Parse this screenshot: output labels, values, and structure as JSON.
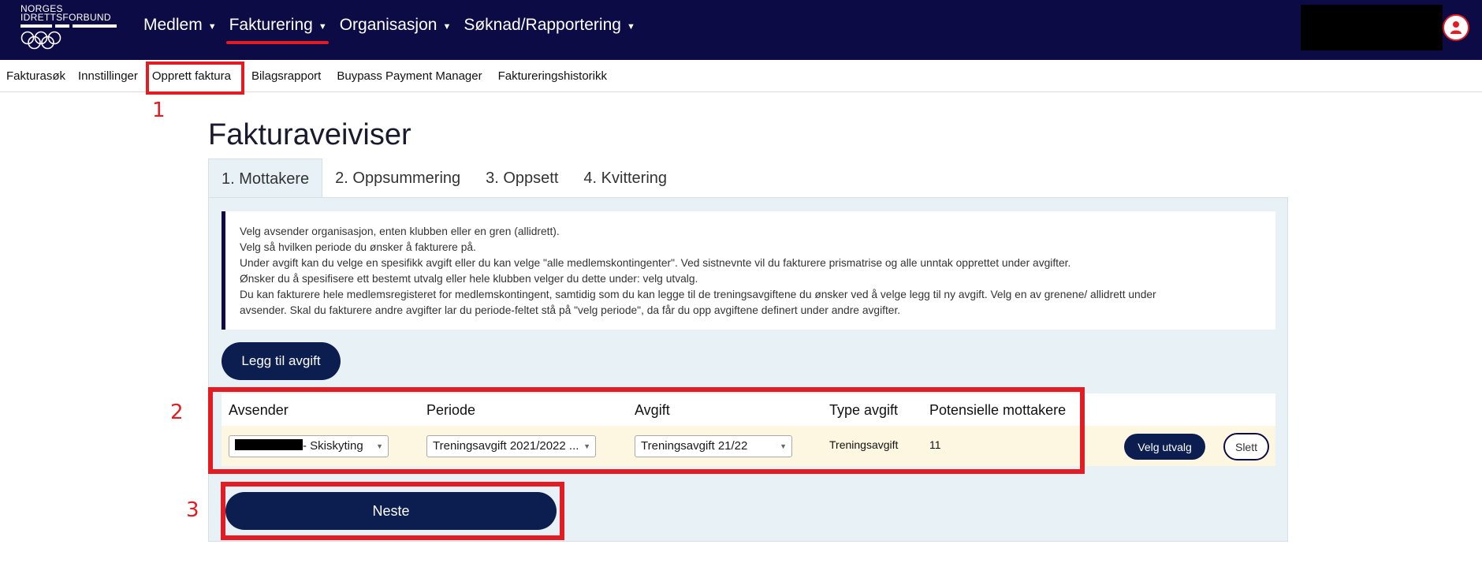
{
  "logo": {
    "line1": "NORGES",
    "line2": "IDRETTSFORBUND"
  },
  "nav": {
    "items": [
      {
        "label": "Medlem"
      },
      {
        "label": "Fakturering"
      },
      {
        "label": "Organisasjon"
      },
      {
        "label": "Søknad/Rapportering"
      }
    ]
  },
  "subnav": {
    "items": [
      {
        "label": "Fakturasøk"
      },
      {
        "label": "Innstillinger"
      },
      {
        "label": "Opprett faktura"
      },
      {
        "label": "Bilagsrapport"
      },
      {
        "label": "Buypass Payment Manager"
      },
      {
        "label": "Faktureringshistorikk"
      }
    ]
  },
  "annotations": {
    "step1": "1",
    "step2": "2",
    "step3": "3"
  },
  "page": {
    "title": "Fakturaveiviser"
  },
  "tabs": [
    {
      "label": "1. Mottakere"
    },
    {
      "label": "2. Oppsummering"
    },
    {
      "label": "3. Oppsett"
    },
    {
      "label": "4. Kvittering"
    }
  ],
  "info": {
    "lines": [
      "Velg avsender organisasjon, enten klubben eller en gren (allidrett).",
      "Velg så hvilken periode du ønsker å fakturere på.",
      "Under avgift kan du velge en spesifikk avgift eller du kan velge \"alle medlemskontingenter\". Ved sistnevnte vil du fakturere prismatrise og alle unntak opprettet under avgifter.",
      "Ønsker du å spesifisere ett bestemt utvalg eller hele klubben velger du dette under: velg utvalg.",
      "Du kan fakturere hele medlemsregisteret for medlemskontingent, samtidig som du kan legge til de treningsavgiftene du ønsker ved å velge legg til ny avgift. Velg en av grenene/ allidrett under",
      "avsender. Skal du fakturere andre avgifter lar du periode-feltet stå på \"velg periode\", da får du opp avgiftene definert under andre avgifter."
    ]
  },
  "buttons": {
    "add_fee": "Legg til avgift",
    "next": "Neste",
    "select_group": "Velg utvalg",
    "delete": "Slett"
  },
  "table": {
    "headers": {
      "sender": "Avsender",
      "period": "Periode",
      "fee": "Avgift",
      "fee_type": "Type avgift",
      "recipients": "Potensielle mottakere"
    },
    "row": {
      "sender_suffix": "- Skiskyting",
      "period": "Treningsavgift 2021/2022 ...",
      "fee": "Treningsavgift 21/22",
      "fee_type": "Treningsavgift",
      "recipients": "11"
    }
  },
  "colors": {
    "navy": "#0c0b45",
    "highlight": "#e31b23",
    "panel": "#e8f1f5",
    "row": "#fdf7e1"
  }
}
